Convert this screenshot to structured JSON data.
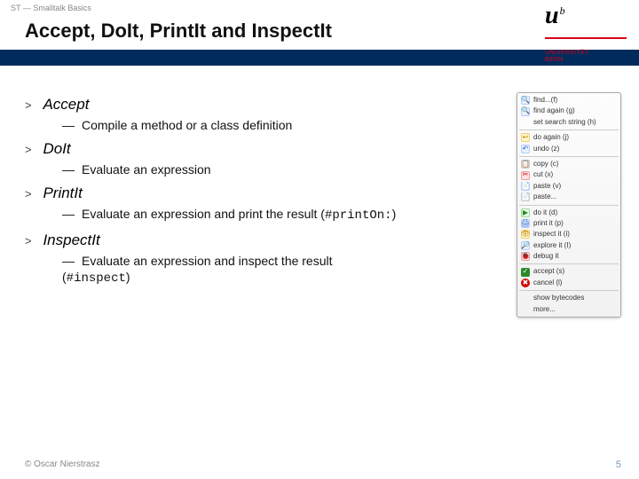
{
  "header": "ST — Smalltalk Basics",
  "title": "Accept, DoIt, PrintIt and InspectIt",
  "logo": {
    "u": "u",
    "sup": "b",
    "line1": "UNIVERSITÄT",
    "line2": "BERN"
  },
  "items": [
    {
      "term": "Accept",
      "desc": "Compile a method or a class definition"
    },
    {
      "term": "DoIt",
      "desc": "Evaluate an expression"
    },
    {
      "term": "PrintIt",
      "desc": "Evaluate an expression and print the result (",
      "code": "#printOn:",
      "desc_tail": ")"
    },
    {
      "term": "InspectIt",
      "desc": "Evaluate an expression and inspect the result (",
      "code": "#inspect",
      "desc_tail": ")"
    }
  ],
  "menu": [
    {
      "icon": "🔍",
      "cls": "ic-blue",
      "label": "find...(f)"
    },
    {
      "icon": "🔍",
      "cls": "ic-blue",
      "label": "find again (g)"
    },
    {
      "icon": "",
      "cls": "",
      "label": "set search string (h)"
    },
    {
      "sep": true
    },
    {
      "icon": "↩",
      "cls": "ic-yellow",
      "label": "do again (j)"
    },
    {
      "icon": "↶",
      "cls": "ic-blue",
      "label": "undo (z)"
    },
    {
      "sep": true
    },
    {
      "icon": "📋",
      "cls": "ic-gray",
      "label": "copy (c)"
    },
    {
      "icon": "✂",
      "cls": "ic-red",
      "label": "cut (x)"
    },
    {
      "icon": "📄",
      "cls": "ic-blue",
      "label": "paste (v)"
    },
    {
      "icon": "📄",
      "cls": "ic-gray",
      "label": "paste..."
    },
    {
      "sep": true
    },
    {
      "icon": "▶",
      "cls": "ic-green",
      "label": "do it (d)"
    },
    {
      "icon": "🖨",
      "cls": "ic-blue",
      "label": "print it (p)"
    },
    {
      "icon": "👁",
      "cls": "ic-yellow",
      "label": "inspect it (i)"
    },
    {
      "icon": "🔎",
      "cls": "ic-blue",
      "label": "explore it (I)"
    },
    {
      "icon": "🐞",
      "cls": "ic-red",
      "label": "debug it"
    },
    {
      "sep": true
    },
    {
      "icon": "✓",
      "cls": "ic-accept",
      "label": "accept (s)"
    },
    {
      "icon": "✖",
      "cls": "ic-cancel",
      "label": "cancel (l)"
    },
    {
      "sep": true
    },
    {
      "icon": "",
      "cls": "",
      "label": "show bytecodes"
    },
    {
      "icon": "",
      "cls": "",
      "label": "more..."
    }
  ],
  "footer": {
    "copyright": "© Oscar Nierstrasz",
    "page": "5"
  }
}
